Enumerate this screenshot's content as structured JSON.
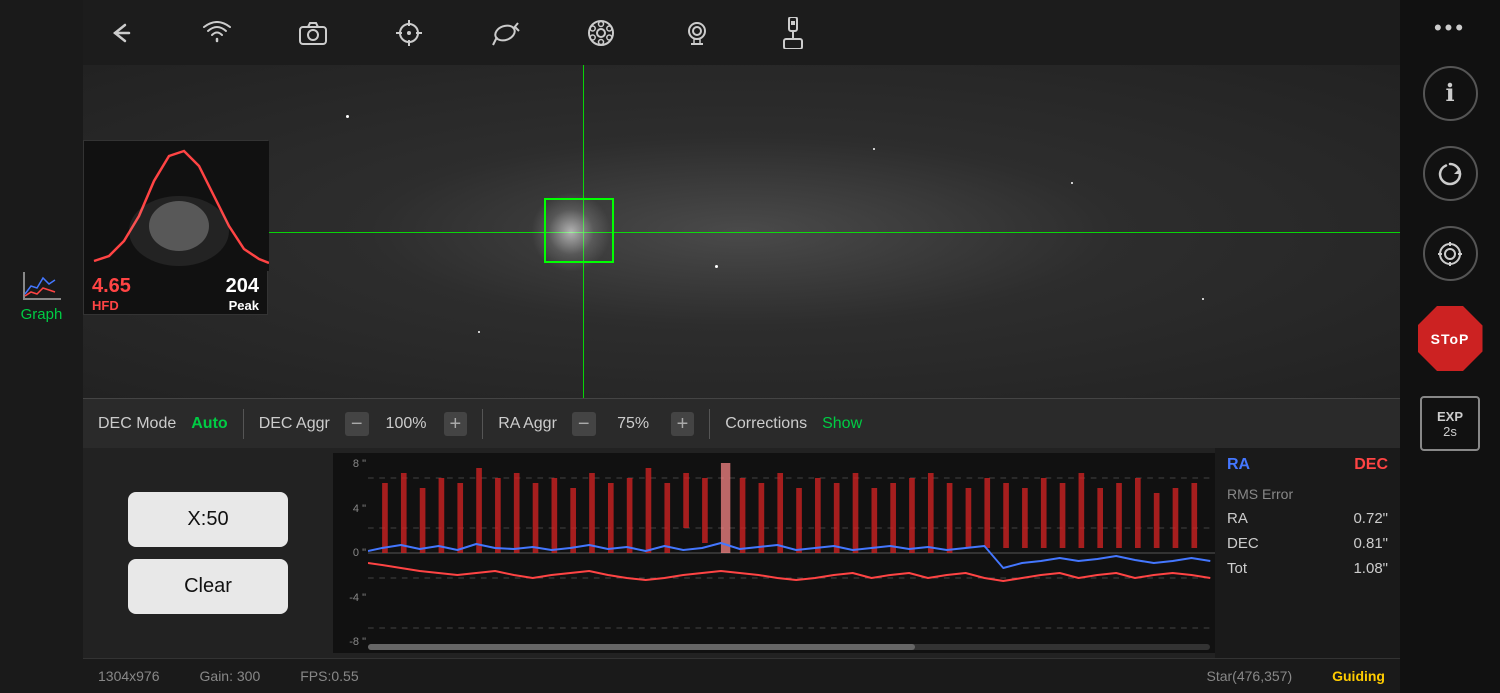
{
  "toolbar": {
    "back_icon": "←",
    "wifi_icon": "wifi",
    "camera_icon": "📷",
    "crosshair_icon": "⊕",
    "telescope_icon": "🔭",
    "reel_icon": "🎞",
    "webcam_icon": "📷",
    "usb_icon": "usb"
  },
  "hfd": {
    "value": "4.65",
    "label": "HFD",
    "peak_value": "204",
    "peak_label": "Peak"
  },
  "graph_button": {
    "label": "Graph"
  },
  "controls": {
    "dec_mode_label": "DEC Mode",
    "dec_mode_value": "Auto",
    "dec_aggr_label": "DEC Aggr",
    "dec_aggr_minus": "−",
    "dec_aggr_pct": "100%",
    "dec_aggr_plus": "+",
    "ra_aggr_label": "RA Aggr",
    "ra_aggr_minus": "−",
    "ra_aggr_pct": "75%",
    "ra_aggr_plus": "+",
    "corrections_label": "Corrections",
    "corrections_value": "Show"
  },
  "bottom_controls": {
    "x_button": "X:50",
    "clear_button": "Clear"
  },
  "graph": {
    "y_labels": [
      "8 \"",
      "4 \"",
      "0 \"",
      "-4 \"",
      "-8 \""
    ]
  },
  "stats": {
    "ra_label": "RA",
    "dec_label": "DEC",
    "rms_error_label": "RMS Error",
    "ra_row_label": "RA",
    "ra_row_value": "0.72\"",
    "dec_row_label": "DEC",
    "dec_row_value": "0.81\"",
    "tot_row_label": "Tot",
    "tot_row_value": "1.08\""
  },
  "footer": {
    "resolution": "1304x976",
    "gain": "Gain: 300",
    "fps": "FPS:0.55",
    "star": "Star(476,357)",
    "guiding": "Guiding"
  },
  "right_sidebar": {
    "more_dots": "•••",
    "info_icon": "ℹ",
    "refresh_icon": "↻",
    "target_icon": "⊕",
    "stop_label": "SToP",
    "exp_label": "EXP",
    "exp_value": "2s"
  }
}
